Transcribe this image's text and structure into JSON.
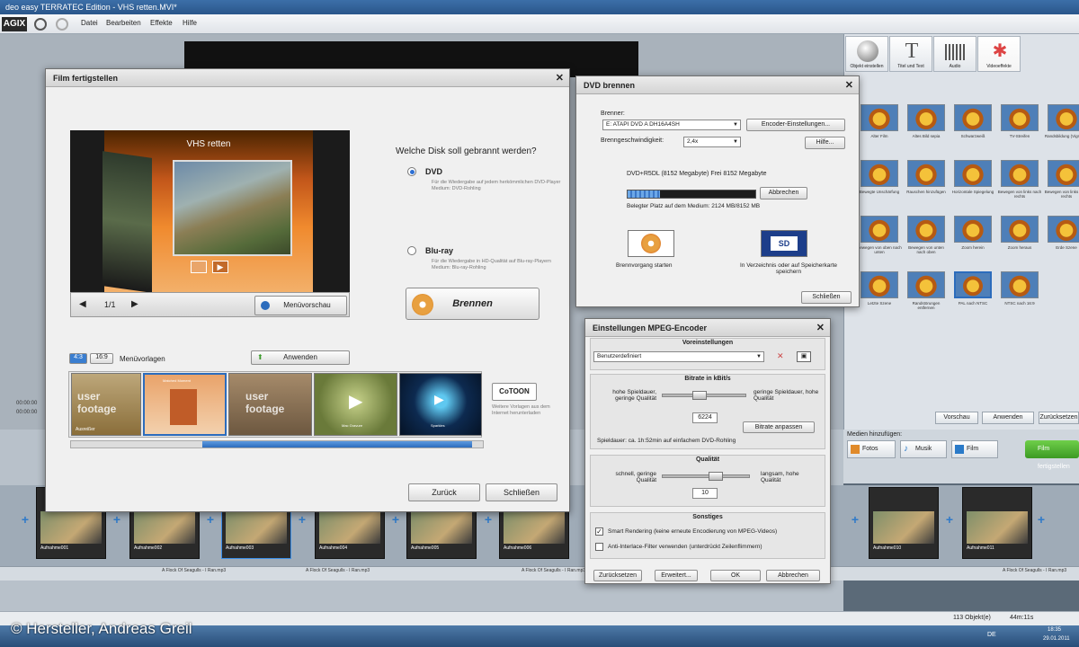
{
  "app": {
    "title": "deo easy TERRATEC Edition - VHS retten.MVI*",
    "logo": "AGIX",
    "menu": [
      "Datei",
      "Bearbeiten",
      "Effekte",
      "Hilfe"
    ]
  },
  "right_panel": {
    "tabs": [
      "Objekt einstellen",
      "Titel und Text",
      "Audio",
      "Videoeffekte"
    ],
    "effects": [
      "Alter Film",
      "Altes Bild sepia",
      "Schwarzweiß",
      "TV-Streifen",
      "Randsbildung (Vignette)",
      "Bewegte Unschärfung",
      "Rauschen hinzufügen",
      "Horizontale Spiegelung",
      "Bewegen von links nach rechts",
      "Bewegen von links nach rechts",
      "Bewegen von oben nach unten",
      "Bewegen von unten nach oben",
      "Zoom herein",
      "Zoom heraus",
      "Erde Szene",
      "Letzte Szene",
      "Randstörungen entfernen",
      "PAL nach NTSC",
      "NTSC nach 16:9"
    ],
    "buttons": [
      "Vorschau",
      "Anwenden",
      "Zurücksetzen"
    ],
    "media_label": "Medien hinzufügen:",
    "media_buttons": [
      "Fotos",
      "Musik",
      "Film"
    ],
    "finish": "Film fertigstellen"
  },
  "timeline": {
    "clips": [
      "Aufnahme001",
      "Aufnahme002",
      "Aufnahme003",
      "Aufnahme004",
      "Aufnahme005",
      "Aufnahme006",
      "Aufnahme010",
      "Aufnahme011"
    ],
    "times": [
      "00:00:00",
      "00:00:00"
    ],
    "audio": [
      "A Flock Of Seagulls - I Ran.mp3",
      "A Flock Of Seagulls - I Ran.mp3",
      "A Flock Of Seagulls - I Ran.mp3",
      "A Flock Of Seagulls - I Ran.mp3"
    ],
    "status_objects": "113 Objekt(e)",
    "status_time": "44m:11s"
  },
  "film_dialog": {
    "title": "Film fertigstellen",
    "menu_title": "VHS retten",
    "page": "1/1",
    "preview_button": "Menüvorschau",
    "question": "Welche Disk soll gebrannt werden?",
    "dvd_label": "DVD",
    "dvd_desc": "Für die Wiedergabe auf jedem herkömmlichen DVD-Player\nMedium: DVD-Rohling",
    "bluray_label": "Blu-ray",
    "bluray_desc": "Für die Wiedergabe in HD-Qualität auf Blu-ray-Playern\nMedium: Blu-ray-Rohling",
    "burn_button": "Brennen",
    "aspect": [
      "4:3",
      "16:9"
    ],
    "templates_label": "Menüvorlagen",
    "apply_button": "Anwenden",
    "template_names": [
      "Ausreißer",
      "Matched Moment",
      "",
      "Mac Gravure",
      "Sparkles"
    ],
    "template_text": [
      "user footage",
      "",
      "user footage",
      "",
      ""
    ],
    "cotoon": "CoTOON",
    "download_text": "Weitere Vorlagen aus dem Internet herunterladen",
    "back_button": "Zurück",
    "close_button": "Schließen"
  },
  "dvd_dialog": {
    "title": "DVD brennen",
    "burner_label": "Brenner:",
    "burner_value": "E: ATAPI DVD A DH16A4SH",
    "encoder_button": "Encoder-Einstellungen...",
    "speed_label": "Brenngeschwindigkeit:",
    "speed_value": "2,4x",
    "help_button": "Hilfe...",
    "disc_info": "DVD+R5DL (8152 Megabyte) Frei 8152 Megabyte",
    "progress": 0.25,
    "cancel_button": "Abbrechen",
    "used_space": "Belegter Platz auf dem Medium: 2124 MB/8152 MB",
    "start_label": "Brennvorgang starten",
    "save_label": "In Verzeichnis oder auf Speicherkarte speichern",
    "close_button": "Schließen"
  },
  "mpeg_dialog": {
    "title": "Einstellungen MPEG-Encoder",
    "presets_title": "Voreinstellungen",
    "preset_value": "Benutzerdefiniert",
    "bitrate_title": "Bitrate in kBit/s",
    "bitrate_left": "hohe Spieldauer, geringe Qualität",
    "bitrate_right": "geringe Spieldauer, hohe Qualität",
    "bitrate_value": "6224",
    "bitrate_button": "Bitrate anpassen",
    "duration": "Spieldauer: ca. 1h:52min auf einfachem DVD-Rohling",
    "quality_title": "Qualität",
    "quality_left": "schnell, geringe Qualität",
    "quality_right": "langsam, hohe Qualität",
    "quality_value": "10",
    "misc_title": "Sonstiges",
    "smart_render": "Smart Rendering (keine erneute Encodierung von MPEG-Videos)",
    "smart_checked": true,
    "anti_interlace": "Anti-Interlace-Filter verwenden (unterdrückt Zeilenflimmern)",
    "anti_checked": false,
    "reset_button": "Zurücksetzen",
    "advanced_button": "Erweitert...",
    "ok_button": "OK",
    "cancel_button": "Abbrechen"
  },
  "taskbar": {
    "lang": "DE",
    "clock": "18:35",
    "date": "29.01.2011"
  },
  "copyright": "© Hersteller, Andreas Greil",
  "colors": {
    "accent": "#2c6cbc",
    "finish": "#3c9a23"
  }
}
